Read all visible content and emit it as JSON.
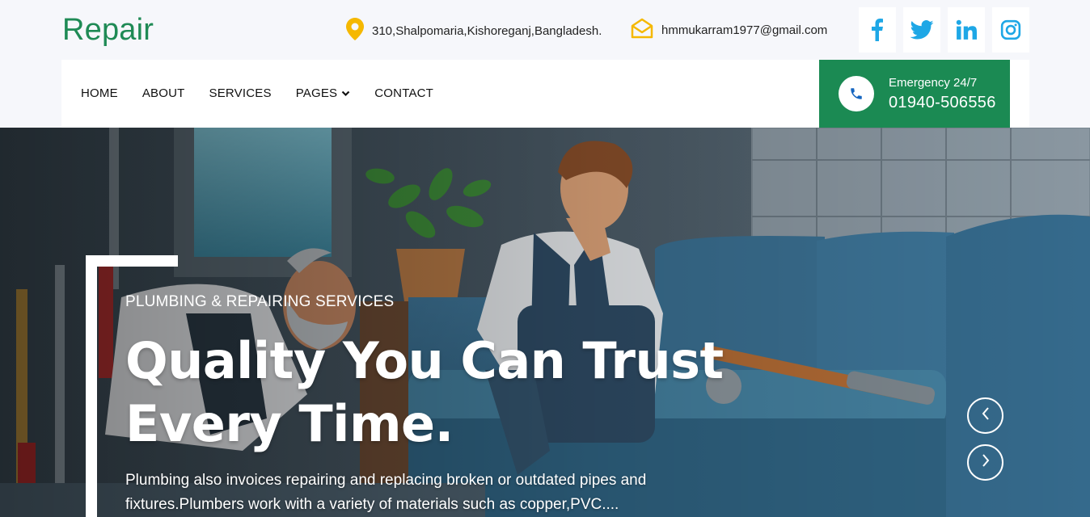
{
  "brand": {
    "logo": "Repair"
  },
  "contact": {
    "address": "310,Shalpomaria,Kishoreganj,Bangladesh.",
    "email": "hmmukarram1977@gmail.com"
  },
  "socials": [
    "facebook-icon",
    "twitter-icon",
    "linkedin-icon",
    "instagram-icon"
  ],
  "nav": {
    "items": [
      {
        "label": "HOME"
      },
      {
        "label": "ABOUT"
      },
      {
        "label": "SERVICES"
      },
      {
        "label": "PAGES"
      },
      {
        "label": "CONTACT"
      }
    ]
  },
  "emergency": {
    "label": "Emergency 24/7",
    "phone": "01940-506556"
  },
  "hero": {
    "kicker": "PLUMBING & REPAIRING SERVICES",
    "headline_line1": "Quality You Can Trust",
    "headline_line2": "Every Time.",
    "description": "Plumbing also invoices repairing and replacing broken or outdated pipes and fixtures.Plumbers work with a variety of materials such as copper,PVC...."
  },
  "colors": {
    "brand_green": "#1f8a55",
    "emergency_bg": "#1b8a53",
    "social_blue": "#1ea7e6",
    "address_pin": "#f5b800"
  }
}
